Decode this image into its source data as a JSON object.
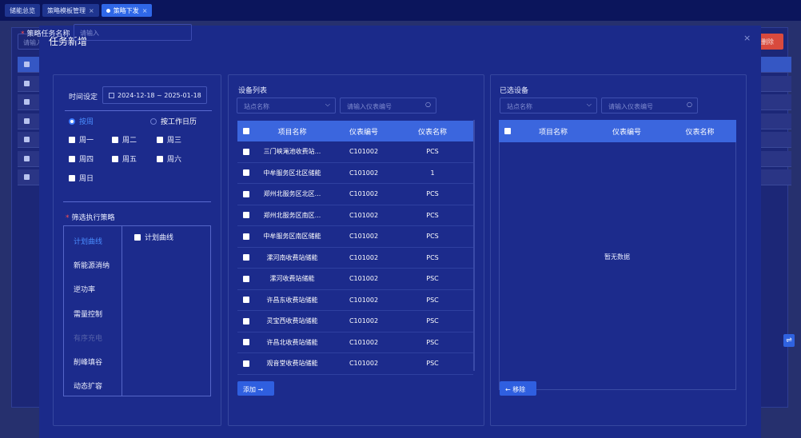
{
  "tabs": [
    {
      "label": "储能总览",
      "active": false,
      "closable": false
    },
    {
      "label": "策略模板管理",
      "active": false,
      "closable": true
    },
    {
      "label": "策略下发",
      "active": true,
      "closable": true
    }
  ],
  "background": {
    "search_placeholder": "请输入",
    "delete_label": "删除",
    "rows": 6
  },
  "modal": {
    "title": "任务新增",
    "close": "×",
    "name_label": "策略任务名称",
    "name_placeholder": "请输入"
  },
  "schedule": {
    "time_label": "时间设定",
    "date_range": "2024-12-18 ~ 2025-01-18",
    "radio_week": "按周",
    "radio_workday": "按工作日历",
    "weekdays": [
      "周一",
      "周二",
      "周三",
      "周四",
      "周五",
      "周六",
      "周日"
    ]
  },
  "strategy": {
    "label": "筛选执行策略",
    "items": [
      "计划曲线",
      "新能源消纳",
      "逆功率",
      "需量控制",
      "有序充电",
      "削峰填谷",
      "动态扩容"
    ],
    "active": 0,
    "disabled": 4,
    "option_label": "计划曲线"
  },
  "device_list": {
    "title": "设备列表",
    "station_placeholder": "站点名称",
    "meter_placeholder": "请输入仪表编号",
    "columns": [
      "项目名称",
      "仪表编号",
      "仪表名称"
    ],
    "rows": [
      [
        "三门峡渑池收费站...",
        "C101002",
        "PCS"
      ],
      [
        "中牟服务区北区储能",
        "C101002",
        "1"
      ],
      [
        "郑州北服务区北区...",
        "C101002",
        "PCS"
      ],
      [
        "郑州北服务区南区...",
        "C101002",
        "PCS"
      ],
      [
        "中牟服务区南区储能",
        "C101002",
        "PCS"
      ],
      [
        "漯河南收费站储能",
        "C101002",
        "PCS"
      ],
      [
        "漯河收费站储能",
        "C101002",
        "PSC"
      ],
      [
        "许昌东收费站储能",
        "C101002",
        "PSC"
      ],
      [
        "灵宝西收费站储能",
        "C101002",
        "PSC"
      ],
      [
        "许昌北收费站储能",
        "C101002",
        "PSC"
      ],
      [
        "观音堂收费站储能",
        "C101002",
        "PSC"
      ]
    ],
    "add_label": "添加 →"
  },
  "selected": {
    "title": "已选设备",
    "station_placeholder": "站点名称",
    "meter_placeholder": "请输入仪表编号",
    "columns": [
      "项目名称",
      "仪表编号",
      "仪表名称"
    ],
    "empty": "暂无数据",
    "remove_label": "← 移除"
  },
  "colors": {
    "accent": "#3b66de",
    "modal_bg": "#1b2a8a",
    "danger": "#d94a3d"
  }
}
